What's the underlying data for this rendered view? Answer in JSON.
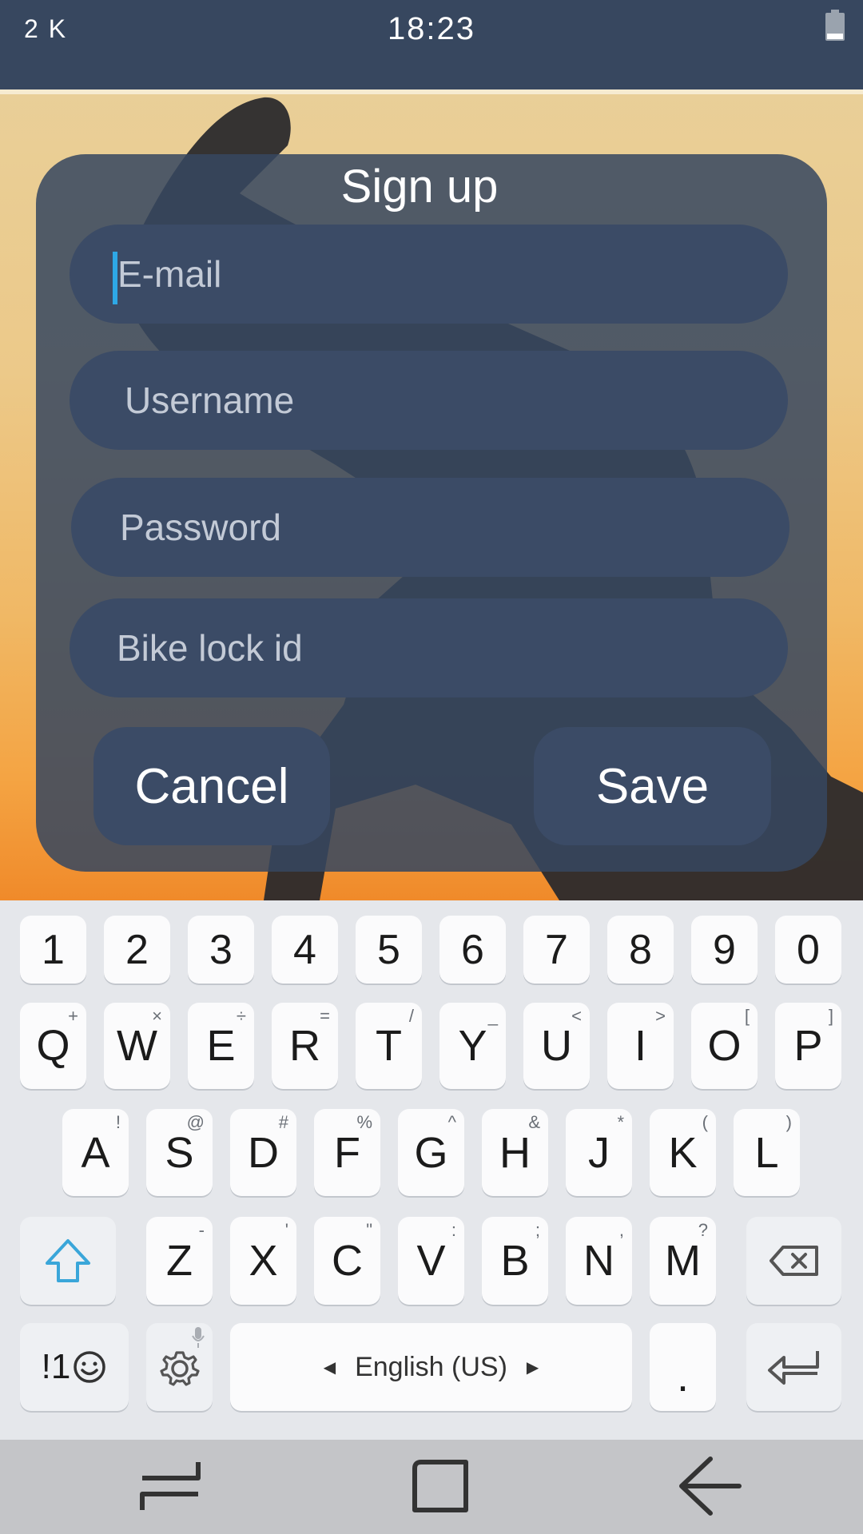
{
  "status_bar": {
    "left_text": "2 K",
    "time": "18:23",
    "battery_icon": "battery-icon"
  },
  "dialog": {
    "title": "Sign up",
    "fields": {
      "email_placeholder": "E-mail",
      "username_placeholder": "Username",
      "password_placeholder": "Password",
      "bike_lock_placeholder": "Bike lock id"
    },
    "cancel_label": "Cancel",
    "save_label": "Save"
  },
  "keyboard": {
    "number_row": [
      "1",
      "2",
      "3",
      "4",
      "5",
      "6",
      "7",
      "8",
      "9",
      "0"
    ],
    "row1": [
      {
        "k": "Q",
        "s": "+"
      },
      {
        "k": "W",
        "s": "×"
      },
      {
        "k": "E",
        "s": "÷"
      },
      {
        "k": "R",
        "s": "="
      },
      {
        "k": "T",
        "s": "/"
      },
      {
        "k": "Y",
        "s": "_"
      },
      {
        "k": "U",
        "s": "<"
      },
      {
        "k": "I",
        "s": ">"
      },
      {
        "k": "O",
        "s": "["
      },
      {
        "k": "P",
        "s": "]"
      }
    ],
    "row2": [
      {
        "k": "A",
        "s": "!"
      },
      {
        "k": "S",
        "s": "@"
      },
      {
        "k": "D",
        "s": "#"
      },
      {
        "k": "F",
        "s": "%"
      },
      {
        "k": "G",
        "s": "^"
      },
      {
        "k": "H",
        "s": "&"
      },
      {
        "k": "J",
        "s": "*"
      },
      {
        "k": "K",
        "s": "("
      },
      {
        "k": "L",
        "s": ")"
      }
    ],
    "row3": [
      {
        "k": "Z",
        "s": "-"
      },
      {
        "k": "X",
        "s": "'"
      },
      {
        "k": "C",
        "s": "\""
      },
      {
        "k": "V",
        "s": ":"
      },
      {
        "k": "B",
        "s": ";"
      },
      {
        "k": "N",
        "s": ","
      },
      {
        "k": "M",
        "s": "?"
      }
    ],
    "symbols_label": "!1",
    "space_label": "English (US)",
    "period_label": ".",
    "icons": [
      "shift-icon",
      "backspace-icon",
      "emoji-icon",
      "settings-icon",
      "mic-icon",
      "enter-icon"
    ]
  },
  "navbar": {
    "icons": [
      "recent-apps-icon",
      "home-icon",
      "back-icon"
    ]
  },
  "colors": {
    "bar": "#37475f",
    "dialog": "#37475f",
    "accent_cursor": "#2ea8e6",
    "shift_icon": "#3aa6d9"
  }
}
